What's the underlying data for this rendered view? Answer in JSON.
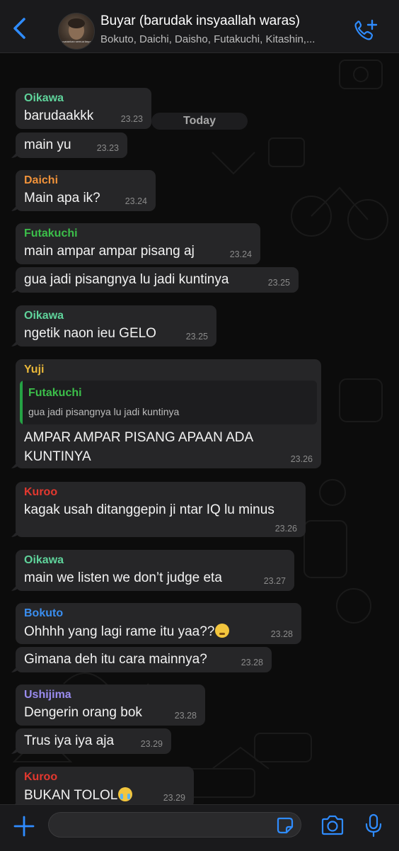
{
  "header": {
    "back_icon": "chevron-left-icon",
    "title": "Buyar (barudak insyaallah waras)",
    "subtitle": "Bokuto, Daichi, Daisho, Futakuchi, Kitashin,...",
    "avatar_caption_top": "",
    "avatar_caption": "kusarankan semua kepadamu",
    "call_icon": "add-call-icon",
    "accent_color": "#2f8cff"
  },
  "chat": {
    "date_label": "Today",
    "messages": [
      {
        "sender": "Oikawa",
        "sender_color": "#5fd39b",
        "text": "barudaakkk",
        "time": "23.23"
      },
      {
        "sender": "",
        "text": "main yu",
        "time": "23.23"
      },
      {
        "sender": "Daichi",
        "sender_color": "#f0923a",
        "text": "Main apa ik?",
        "time": "23.24"
      },
      {
        "sender": "Futakuchi",
        "sender_color": "#3cbf4a",
        "text": "main ampar ampar pisang aj",
        "time": "23.24"
      },
      {
        "sender": "",
        "text": "gua jadi pisangnya lu jadi kuntinya",
        "time": "23.25"
      },
      {
        "sender": "Oikawa",
        "sender_color": "#5fd39b",
        "text": "ngetik naon ieu GELO",
        "time": "23.25"
      },
      {
        "sender": "Yuji",
        "sender_color": "#e8b73a",
        "reply": {
          "sender": "Futakuchi",
          "sender_color": "#3cbf4a",
          "text": "gua jadi pisangnya lu jadi kuntinya"
        },
        "text": "AMPAR AMPAR PISANG APAAN ADA KUNTINYA",
        "time": "23.26"
      },
      {
        "sender": "Kuroo",
        "sender_color": "#e3382f",
        "text": "kagak usah ditanggepin ji ntar IQ lu minus",
        "time": "23.26"
      },
      {
        "sender": "Oikawa",
        "sender_color": "#5fd39b",
        "text": "main we listen we don’t judge eta",
        "time": "23.27"
      },
      {
        "sender": "Bokuto",
        "sender_color": "#3a8ef0",
        "text": "Ohhhh yang lagi rame itu yaa??",
        "emoji": "thinking-face-emoji",
        "time": "23.28"
      },
      {
        "sender": "",
        "text": "Gimana deh itu cara mainnya?",
        "time": "23.28"
      },
      {
        "sender": "Ushijima",
        "sender_color": "#9a8cf0",
        "text": "Dengerin orang bok",
        "time": "23.28"
      },
      {
        "sender": "",
        "text": "Trus iya iya aja",
        "time": "23.29"
      },
      {
        "sender": "Kuroo",
        "sender_color": "#e3382f",
        "text": "BUKAN TOLOL",
        "emoji": "loudly-crying-face-emoji",
        "time": "23.29"
      }
    ]
  },
  "input": {
    "value": "",
    "placeholder": "",
    "plus_icon": "plus-icon",
    "sticker_icon": "sticker-icon",
    "camera_icon": "camera-icon",
    "mic_icon": "microphone-icon"
  }
}
